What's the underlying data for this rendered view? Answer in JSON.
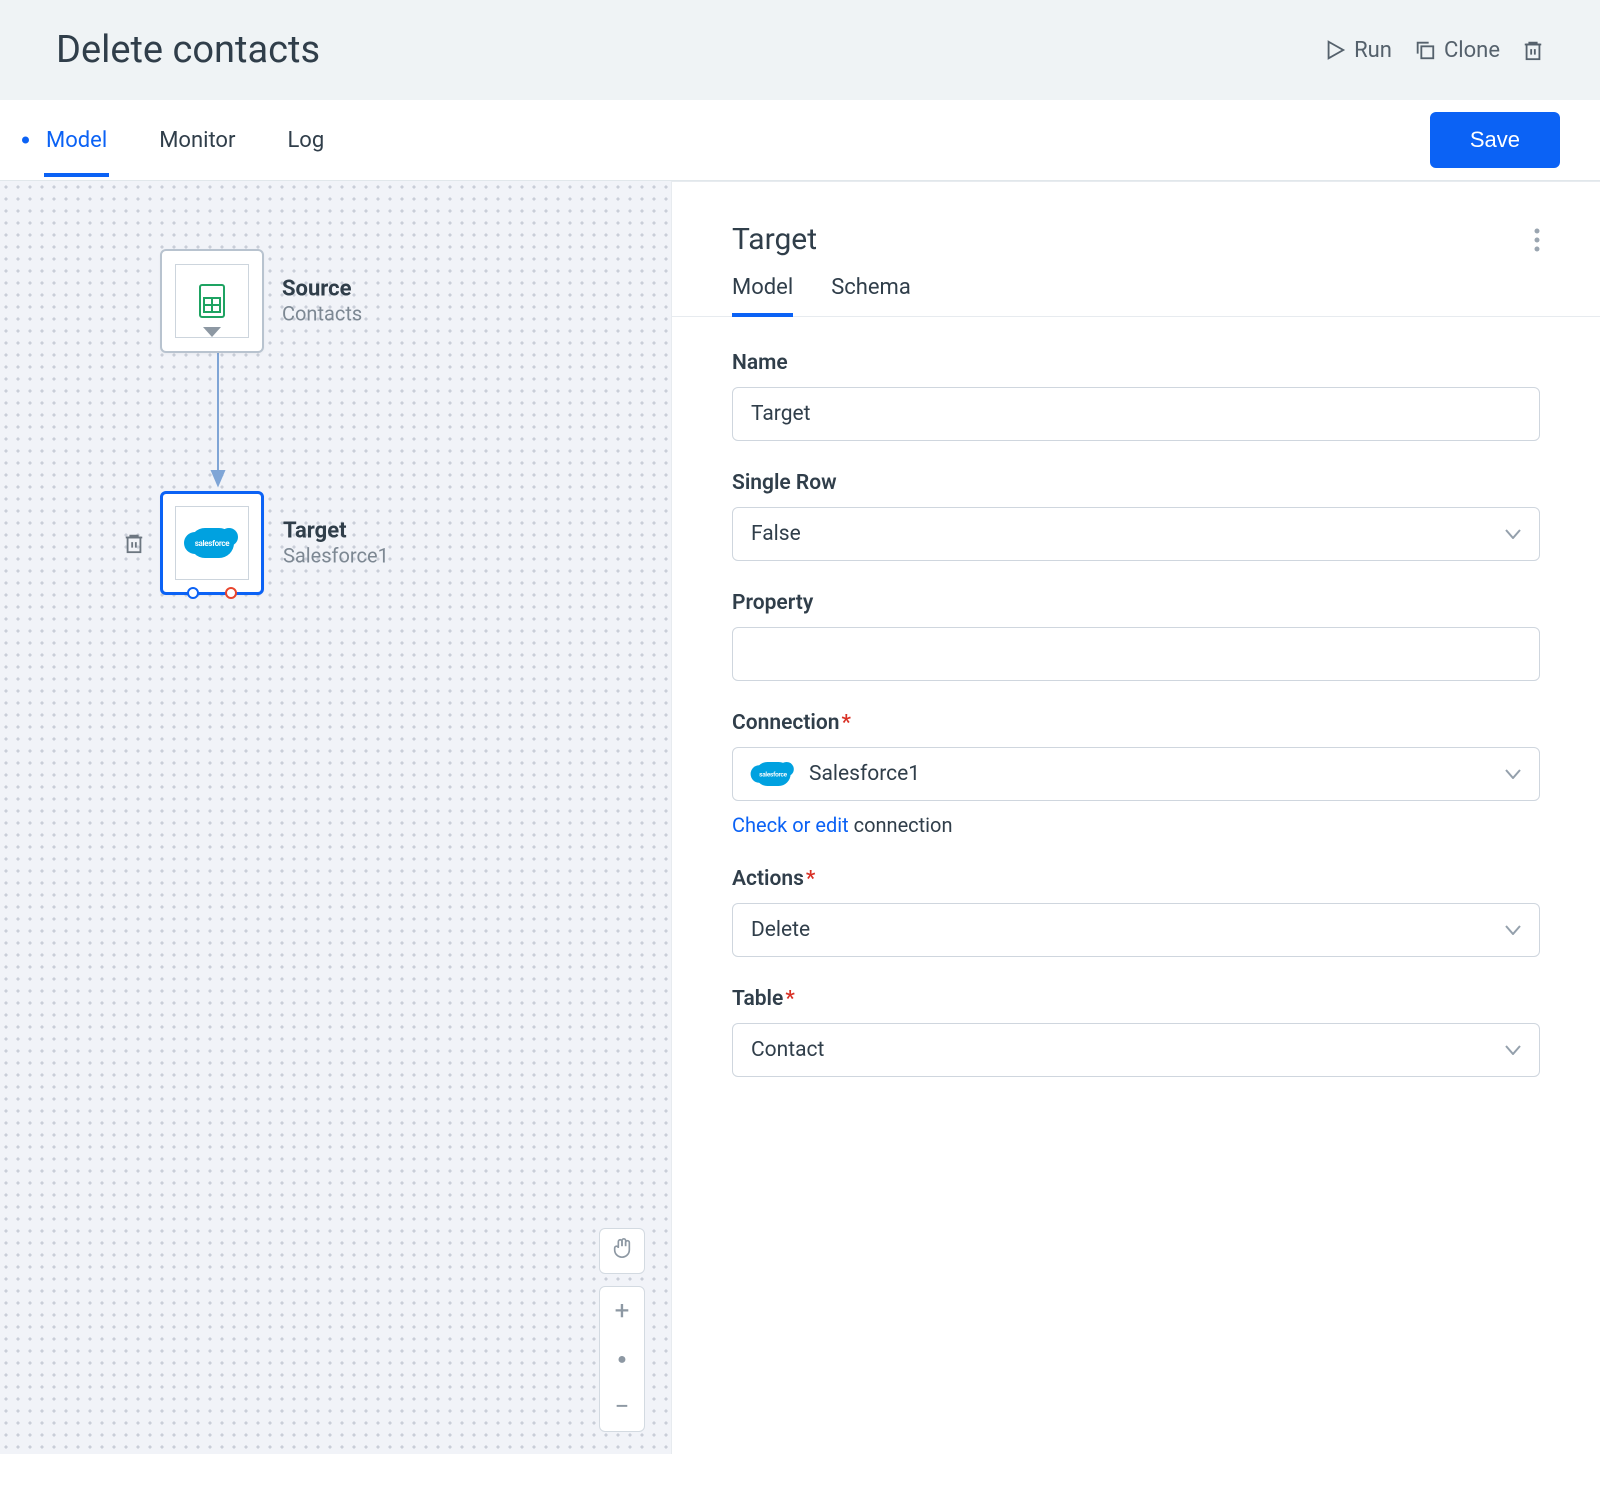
{
  "header": {
    "title": "Delete contacts",
    "actions": {
      "run": "Run",
      "clone": "Clone"
    }
  },
  "tabs": {
    "items": [
      "Model",
      "Monitor",
      "Log"
    ],
    "active": 0,
    "save": "Save"
  },
  "canvas": {
    "source": {
      "title": "Source",
      "subtitle": "Contacts"
    },
    "target": {
      "title": "Target",
      "subtitle": "Salesforce1"
    }
  },
  "panel": {
    "title": "Target",
    "tabs": {
      "model": "Model",
      "schema": "Schema"
    },
    "fields": {
      "name": {
        "label": "Name",
        "value": "Target"
      },
      "singleRow": {
        "label": "Single Row",
        "value": "False"
      },
      "property": {
        "label": "Property",
        "value": ""
      },
      "connection": {
        "label": "Connection",
        "value": "Salesforce1",
        "helper_link": "Check or edit",
        "helper_text": " connection",
        "icon_text": "salesforce"
      },
      "actions": {
        "label": "Actions",
        "value": "Delete"
      },
      "table": {
        "label": "Table",
        "value": "Contact"
      }
    }
  }
}
